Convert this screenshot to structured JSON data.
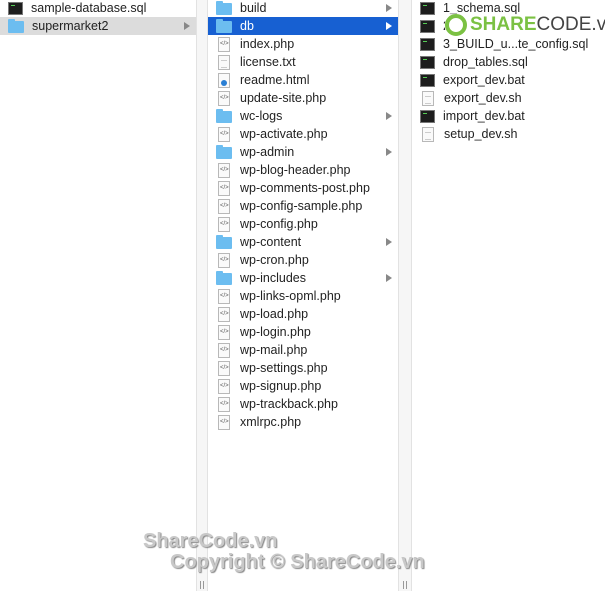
{
  "columns": [
    {
      "items": [
        {
          "name": "sample-database.sql",
          "type": "term"
        },
        {
          "name": "supermarket2",
          "type": "folder",
          "selected": "gray",
          "arrow": true
        }
      ]
    },
    {
      "items": [
        {
          "name": "build",
          "type": "folder",
          "arrow": true
        },
        {
          "name": "db",
          "type": "folder",
          "selected": "blue",
          "arrow": true
        },
        {
          "name": "index.php",
          "type": "code"
        },
        {
          "name": "license.txt",
          "type": "txt"
        },
        {
          "name": "readme.html",
          "type": "html"
        },
        {
          "name": "update-site.php",
          "type": "code"
        },
        {
          "name": "wc-logs",
          "type": "folder",
          "arrow": true
        },
        {
          "name": "wp-activate.php",
          "type": "code"
        },
        {
          "name": "wp-admin",
          "type": "folder",
          "arrow": true
        },
        {
          "name": "wp-blog-header.php",
          "type": "code"
        },
        {
          "name": "wp-comments-post.php",
          "type": "code"
        },
        {
          "name": "wp-config-sample.php",
          "type": "code"
        },
        {
          "name": "wp-config.php",
          "type": "code"
        },
        {
          "name": "wp-content",
          "type": "folder",
          "arrow": true
        },
        {
          "name": "wp-cron.php",
          "type": "code"
        },
        {
          "name": "wp-includes",
          "type": "folder",
          "arrow": true
        },
        {
          "name": "wp-links-opml.php",
          "type": "code"
        },
        {
          "name": "wp-load.php",
          "type": "code"
        },
        {
          "name": "wp-login.php",
          "type": "code"
        },
        {
          "name": "wp-mail.php",
          "type": "code"
        },
        {
          "name": "wp-settings.php",
          "type": "code"
        },
        {
          "name": "wp-signup.php",
          "type": "code"
        },
        {
          "name": "wp-trackback.php",
          "type": "code"
        },
        {
          "name": "xmlrpc.php",
          "type": "code"
        }
      ]
    },
    {
      "items": [
        {
          "name": "1_schema.sql",
          "type": "term"
        },
        {
          "name": "2",
          "type": "term"
        },
        {
          "name": "3_BUILD_u...te_config.sql",
          "type": "term"
        },
        {
          "name": "drop_tables.sql",
          "type": "term"
        },
        {
          "name": "export_dev.bat",
          "type": "term"
        },
        {
          "name": "export_dev.sh",
          "type": "txt"
        },
        {
          "name": "import_dev.bat",
          "type": "term"
        },
        {
          "name": "setup_dev.sh",
          "type": "txt"
        }
      ]
    }
  ],
  "watermark": {
    "logo_green": "SHARE",
    "logo_dark": "CODE.vn",
    "line1": "ShareCode.vn",
    "line2": "Copyright © ShareCode.vn"
  },
  "colors": {
    "selection": "#1760d2",
    "folder": "#6cbdf0"
  }
}
